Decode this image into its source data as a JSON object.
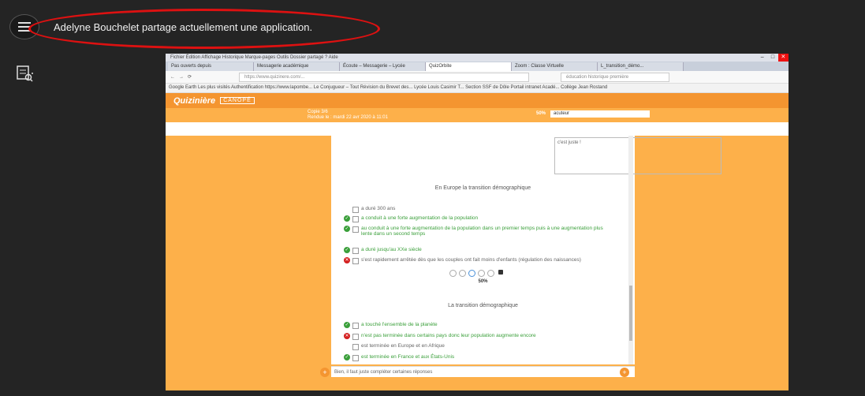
{
  "banner": {
    "share_text": "Adelyne Bouchelet partage actuellement une application."
  },
  "icons": {
    "menu": "hamburger-menu-icon",
    "poll": "poll-icon"
  },
  "shared_browser": {
    "menubar": "Fichier  Édition  Affichage  Historique  Marque-pages  Outils  Dossier partagé  ?  Aide",
    "tabs": [
      "Pas ouverts depuis",
      "Messagerie académique",
      "Écoute – Messagerie – Lycée",
      "QuizOrbite",
      "Zoom : Classe Virtuelle",
      "L_transition_démo..."
    ],
    "url": "https://www.quizinere.com/...",
    "search": "éducation historique première",
    "bookmarks": "Google Earth   Les plus visités   Authentification   https://www.lapombe...   Le Conjugueur – Tout   Révision du Brevet des...   Lycée Louis Casimir T...   Section SSF de Dôle   Portail intranet Acadé...   Collège Jean Rostand",
    "brand": {
      "logo": "Quizinière",
      "sub": "CANOPÉ"
    },
    "info": {
      "line1": "Copie 3/6",
      "line2": "Rendue le : mardi 22 avr 2020 à 11:01",
      "percent": "50%",
      "input_value": "acuteur"
    },
    "feedback_text": "c'est juste !",
    "section1": {
      "title": "En Europe la transition démographique",
      "answers": [
        {
          "text": "a duré 300 ans",
          "mark": "none",
          "color": "gray"
        },
        {
          "text": "a conduit à une forte augmentation de la population",
          "mark": "ok",
          "color": "green"
        },
        {
          "text": "au conduit à une forte augmentation de la population dans un premier temps puis à une augmentation plus lente dans un second temps",
          "mark": "ok",
          "color": "green"
        },
        {
          "text": "a duré jusqu'au XXe siècle",
          "mark": "ok",
          "color": "green"
        },
        {
          "text": "s'est rapidement arrêtée dès que les couples ont fait moins d'enfants (régulation des naissances)",
          "mark": "bad",
          "color": "gray"
        }
      ]
    },
    "progress_label": "50%",
    "section2": {
      "title": "La transition démographique",
      "answers": [
        {
          "text": "a touché l'ensemble de la planète",
          "mark": "ok",
          "color": "green"
        },
        {
          "text": "n'est pas terminée dans certains pays donc leur population augmente encore",
          "mark": "bad",
          "color": "green"
        },
        {
          "text": "est terminée en Europe et en Afrique",
          "mark": "none",
          "color": "gray"
        },
        {
          "text": "est terminée en France et aux États-Unis",
          "mark": "ok",
          "color": "green"
        }
      ]
    },
    "comment": "Bien, il faut juste compléter certaines réponses"
  }
}
